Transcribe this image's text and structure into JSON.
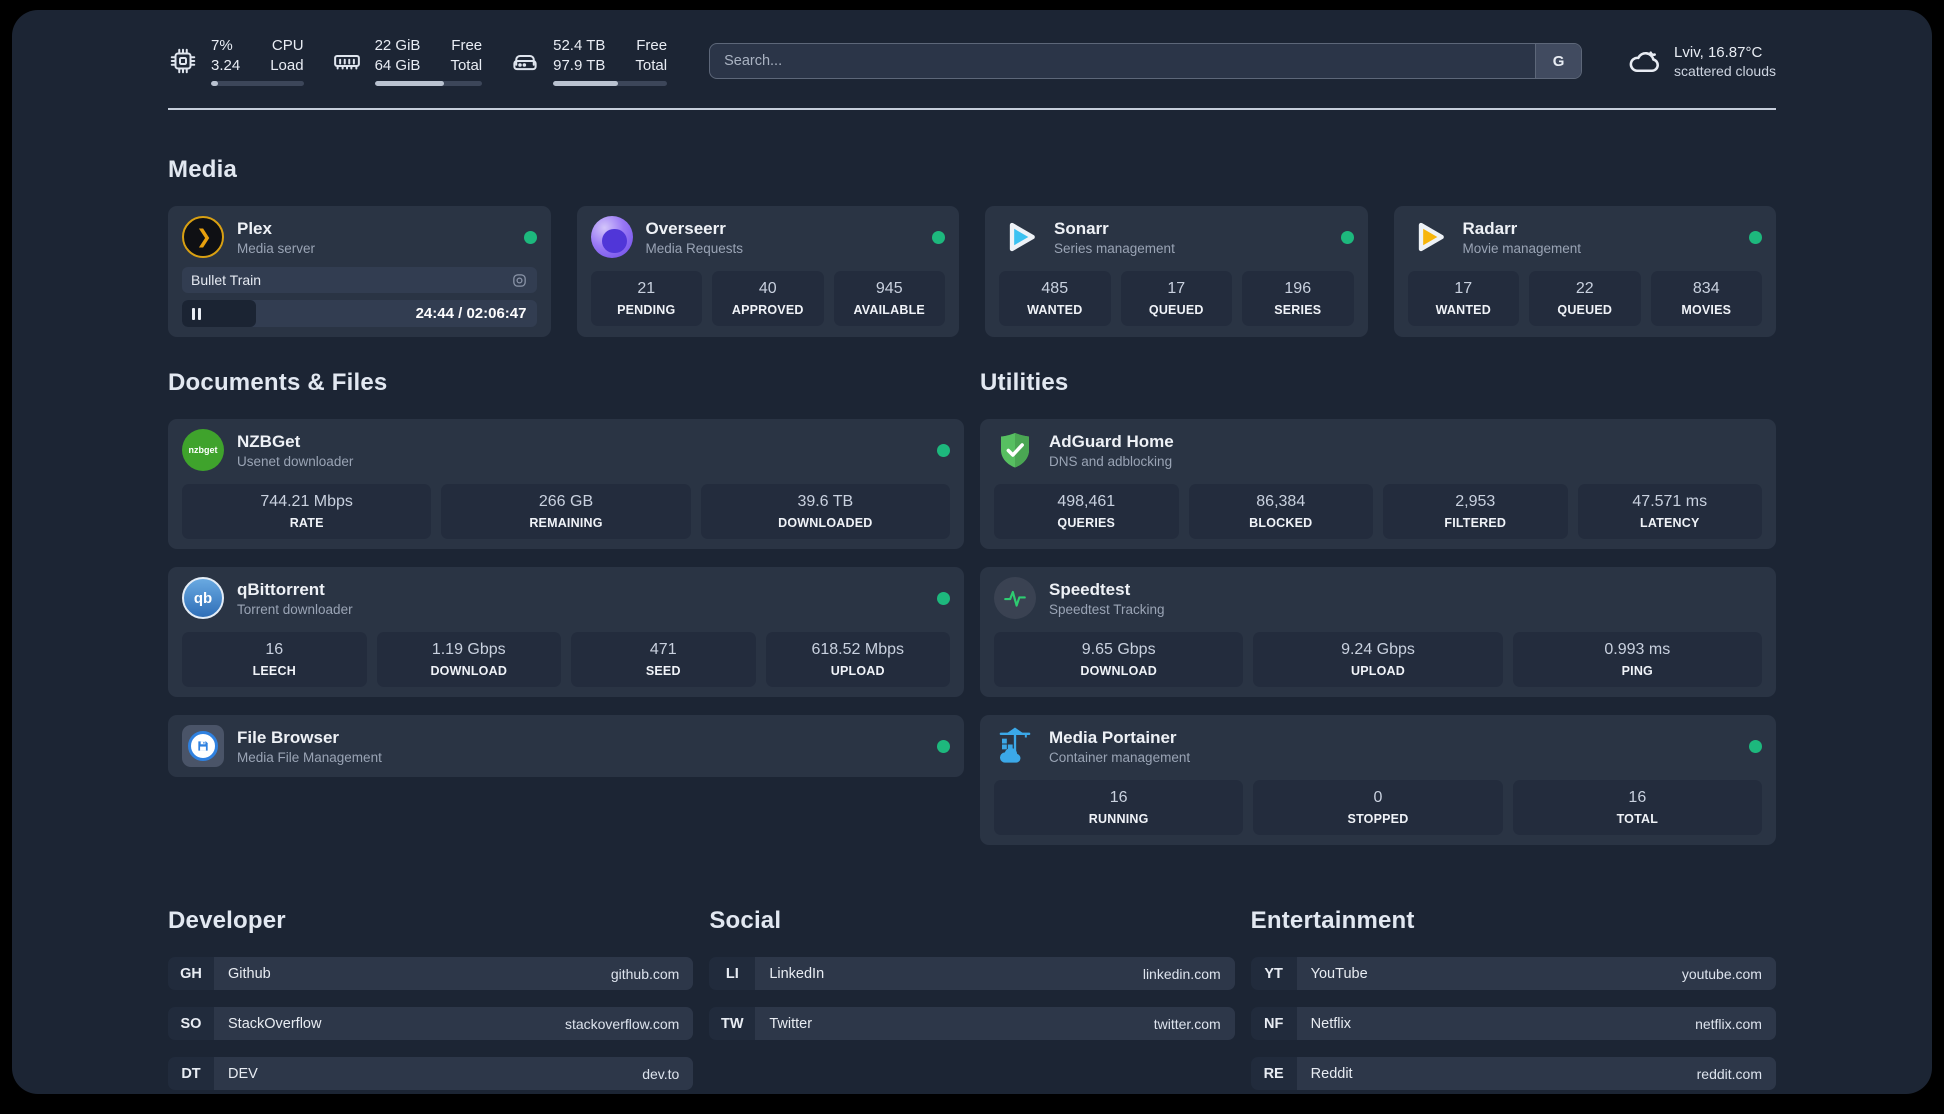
{
  "colors": {
    "status_online": "#1db87d",
    "page_bg": "#1c2534",
    "card_bg": "#2a3444"
  },
  "header": {
    "stats": [
      {
        "icon": "cpu-icon",
        "values": [
          "7%",
          "3.24"
        ],
        "labels": [
          "CPU",
          "Load"
        ],
        "progress_pct": 8
      },
      {
        "icon": "ram-icon",
        "values": [
          "22 GiB",
          "64 GiB"
        ],
        "labels": [
          "Free",
          "Total"
        ],
        "progress_pct": 65
      },
      {
        "icon": "disk-icon",
        "values": [
          "52.4 TB",
          "97.9 TB"
        ],
        "labels": [
          "Free",
          "Total"
        ],
        "progress_pct": 57
      }
    ],
    "search": {
      "placeholder": "Search...",
      "engine_label": "G"
    },
    "weather": {
      "summary": "Lviv, 16.87°C",
      "condition": "scattered clouds",
      "icon": "cloud-icon"
    }
  },
  "sections": {
    "media": {
      "title": "Media",
      "apps": [
        {
          "name": "Plex",
          "desc": "Media server",
          "icon": "plex-icon",
          "online": true,
          "player": {
            "title": "Bullet Train",
            "time": "24:44 / 02:06:47",
            "progress_pct": 21
          }
        },
        {
          "name": "Overseerr",
          "desc": "Media Requests",
          "icon": "overseerr-icon",
          "online": true,
          "stats": [
            {
              "value": "21",
              "label": "PENDING"
            },
            {
              "value": "40",
              "label": "APPROVED"
            },
            {
              "value": "945",
              "label": "AVAILABLE"
            }
          ]
        },
        {
          "name": "Sonarr",
          "desc": "Series management",
          "icon": "sonarr-icon",
          "online": true,
          "stats": [
            {
              "value": "485",
              "label": "WANTED"
            },
            {
              "value": "17",
              "label": "QUEUED"
            },
            {
              "value": "196",
              "label": "SERIES"
            }
          ]
        },
        {
          "name": "Radarr",
          "desc": "Movie management",
          "icon": "radarr-icon",
          "online": true,
          "stats": [
            {
              "value": "17",
              "label": "WANTED"
            },
            {
              "value": "22",
              "label": "QUEUED"
            },
            {
              "value": "834",
              "label": "MOVIES"
            }
          ]
        }
      ]
    },
    "documents": {
      "title": "Documents & Files",
      "apps": [
        {
          "name": "NZBGet",
          "desc": "Usenet downloader",
          "icon": "nzbget-icon",
          "online": true,
          "stats": [
            {
              "value": "744.21 Mbps",
              "label": "RATE"
            },
            {
              "value": "266 GB",
              "label": "REMAINING"
            },
            {
              "value": "39.6 TB",
              "label": "DOWNLOADED"
            }
          ]
        },
        {
          "name": "qBittorrent",
          "desc": "Torrent downloader",
          "icon": "qbittorrent-icon",
          "online": true,
          "stats": [
            {
              "value": "16",
              "label": "LEECH"
            },
            {
              "value": "1.19 Gbps",
              "label": "DOWNLOAD"
            },
            {
              "value": "471",
              "label": "SEED"
            },
            {
              "value": "618.52 Mbps",
              "label": "UPLOAD"
            }
          ]
        },
        {
          "name": "File Browser",
          "desc": "Media File Management",
          "icon": "filebrowser-icon",
          "online": true
        }
      ]
    },
    "utilities": {
      "title": "Utilities",
      "apps": [
        {
          "name": "AdGuard Home",
          "desc": "DNS and adblocking",
          "icon": "adguard-icon",
          "online": false,
          "stats": [
            {
              "value": "498,461",
              "label": "QUERIES"
            },
            {
              "value": "86,384",
              "label": "BLOCKED"
            },
            {
              "value": "2,953",
              "label": "FILTERED"
            },
            {
              "value": "47.571 ms",
              "label": "LATENCY"
            }
          ]
        },
        {
          "name": "Speedtest",
          "desc": "Speedtest Tracking",
          "icon": "speedtest-icon",
          "online": false,
          "stats": [
            {
              "value": "9.65 Gbps",
              "label": "DOWNLOAD"
            },
            {
              "value": "9.24 Gbps",
              "label": "UPLOAD"
            },
            {
              "value": "0.993 ms",
              "label": "PING"
            }
          ]
        },
        {
          "name": "Media Portainer",
          "desc": "Container management",
          "icon": "portainer-icon",
          "online": true,
          "stats": [
            {
              "value": "16",
              "label": "RUNNING"
            },
            {
              "value": "0",
              "label": "STOPPED"
            },
            {
              "value": "16",
              "label": "TOTAL"
            }
          ]
        }
      ]
    },
    "links": [
      {
        "title": "Developer",
        "items": [
          {
            "badge": "GH",
            "name": "Github",
            "url": "github.com"
          },
          {
            "badge": "SO",
            "name": "StackOverflow",
            "url": "stackoverflow.com"
          },
          {
            "badge": "DT",
            "name": "DEV",
            "url": "dev.to"
          }
        ]
      },
      {
        "title": "Social",
        "items": [
          {
            "badge": "LI",
            "name": "LinkedIn",
            "url": "linkedin.com"
          },
          {
            "badge": "TW",
            "name": "Twitter",
            "url": "twitter.com"
          }
        ]
      },
      {
        "title": "Entertainment",
        "items": [
          {
            "badge": "YT",
            "name": "YouTube",
            "url": "youtube.com"
          },
          {
            "badge": "NF",
            "name": "Netflix",
            "url": "netflix.com"
          },
          {
            "badge": "RE",
            "name": "Reddit",
            "url": "reddit.com"
          }
        ]
      }
    ]
  }
}
